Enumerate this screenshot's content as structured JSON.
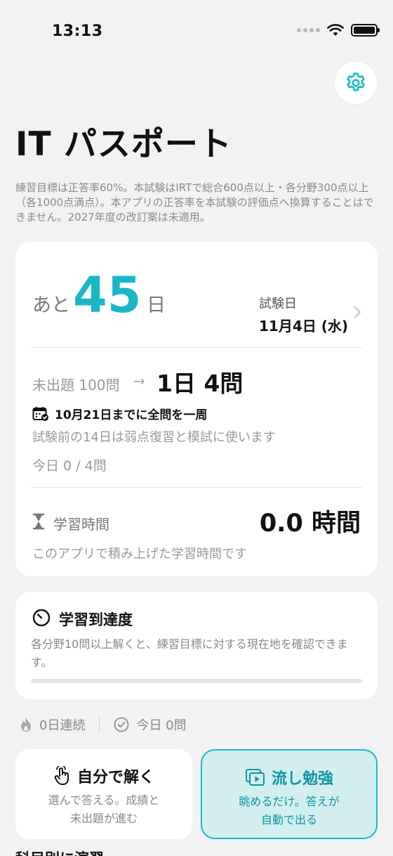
{
  "status_bar": {
    "time": "13:13"
  },
  "header": {
    "title": "IT パスポート"
  },
  "notice": "練習目標は正答率60%。本試験はIRTで総合600点以上・各分野300点以上（各1000点満点）。本アプリの正答率を本試験の評価点へ換算することはできません。2027年度の改訂案は未適用。",
  "countdown": {
    "prefix": "あと",
    "days": "45",
    "unit": "日",
    "exam_label": "試験日",
    "exam_date": "11月4日 (水)"
  },
  "plan": {
    "remaining_label": "未出題 100問",
    "arrow": "→",
    "daily_goal": "1日 4問",
    "deadline": "10月21日までに全問を一周",
    "deadline_sub": "試験前の14日は弱点復習と模試に使います",
    "today_progress": "今日 0 / 4問"
  },
  "study_time": {
    "label": "学習時間",
    "value": "0.0 時間",
    "sub": "このアプリで積み上げた学習時間です"
  },
  "mastery": {
    "title": "学習到達度",
    "description": "各分野10問以上解くと、練習目標に対する現在地を確認できます。",
    "progress": 0
  },
  "stats": {
    "streak": "0日連続",
    "today_count": "今日 0問"
  },
  "modes": {
    "self": {
      "title": "自分で解く",
      "sub1": "選んで答える。成績と",
      "sub2": "未出題が進む"
    },
    "stream": {
      "title": "流し勉強",
      "sub1": "眺めるだけ。答えが",
      "sub2": "自動で出る"
    }
  },
  "next_section": "科目別に演習",
  "colors": {
    "accent": "#1ab8c7",
    "accent_dark": "#0f95a3",
    "accent_bg": "#d3eef1",
    "background": "#f2f2f4"
  },
  "icons": [
    "wifi-icon",
    "battery-icon",
    "gear-icon",
    "chevron-right-icon",
    "calendar-check-icon",
    "hourglass-icon",
    "gauge-icon",
    "flame-icon",
    "check-circle-icon",
    "tap-hand-icon",
    "play-stack-icon"
  ]
}
